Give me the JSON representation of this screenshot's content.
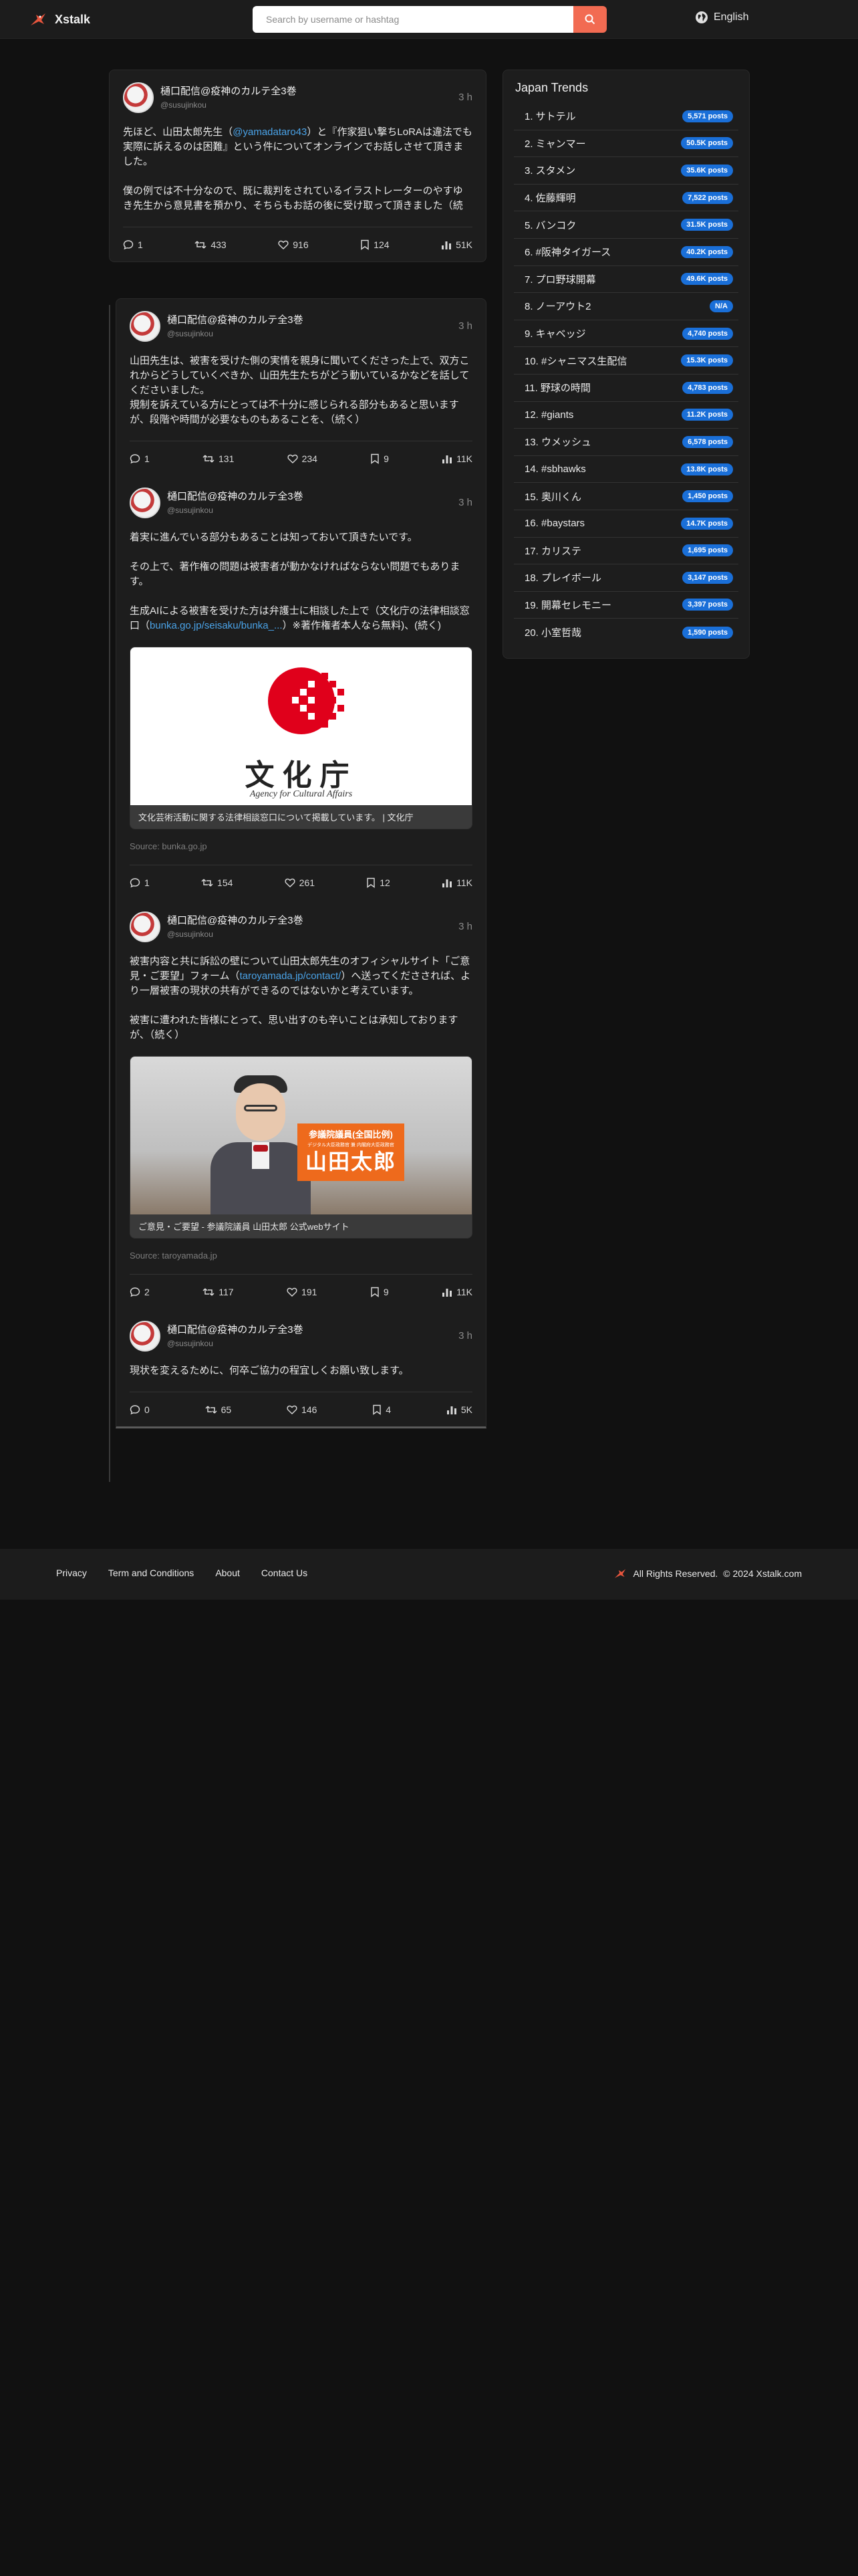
{
  "header": {
    "brand": "Xstalk",
    "search_placeholder": "Search by username or hashtag",
    "language": "English"
  },
  "main_post": {
    "display_name": "樋口配信@疫神のカルテ全3巻",
    "handle": "@susujinkou",
    "time": "3 h",
    "text_1a": "先ほど、山田太郎先生（",
    "text_1link": "@yamadataro43",
    "text_1b": "）と『作家狙い撃ちLoRAは違法でも実際に訴えるのは困難』という件についてオンラインでお話しさせて頂きました。",
    "text_2": "僕の例では不十分なので、既に裁判をされているイラストレーターのやすゆき先生から意見書を預かり、そちらもお話の後に受け取って頂きました（続",
    "replies": "1",
    "reposts": "433",
    "likes": "916",
    "bookmarks": "124",
    "views": "51K"
  },
  "thread": [
    {
      "display_name": "樋口配信@疫神のカルテ全3巻",
      "handle": "@susujinkou",
      "time": "3 h",
      "text_1": "山田先生は、被害を受けた側の実情を親身に聞いてくださった上で、双方これからどうしていくべきか、山田先生たちがどう動いているかなどを話してくださいました。",
      "text_2": "規制を訴えている方にとっては不十分に感じられる部分もあると思いますが、段階や時間が必要なものもあることを、（続く）",
      "replies": "1",
      "reposts": "131",
      "likes": "234",
      "bookmarks": "9",
      "views": "11K"
    },
    {
      "display_name": "樋口配信@疫神のカルテ全3巻",
      "handle": "@susujinkou",
      "time": "3 h",
      "text_1": "着実に進んでいる部分もあることは知っておいて頂きたいです。",
      "text_2": "その上で、著作権の問題は被害者が動かなければならない問題でもあります。",
      "text_3a": "生成AIによる被害を受けた方は弁護士に相談した上で（文化庁の法律相談窓口（",
      "text_3link": "bunka.go.jp/seisaku/bunka_...",
      "text_3b": "）※著作権者本人なら無料)、(続く)",
      "preview_caption": "文化芸術活動に関する法律相談窓口について掲載しています。 | 文化庁",
      "preview_logo_text": "文化庁",
      "preview_logo_en": "Agency for Cultural Affairs",
      "source": "Source: bunka.go.jp",
      "replies": "1",
      "reposts": "154",
      "likes": "261",
      "bookmarks": "12",
      "views": "11K"
    },
    {
      "display_name": "樋口配信@疫神のカルテ全3巻",
      "handle": "@susujinkou",
      "time": "3 h",
      "text_1a": "被害内容と共に訴訟の壁について山田太郎先生のオフィシャルサイト「ご意見・ご要望」フォーム（",
      "text_1link": "taroyamada.jp/contact/",
      "text_1b": "）へ送ってくださされば、より一層被害の現状の共有ができるのではないかと考えています。",
      "text_2": "被害に遭われた皆様にとって、思い出すのも辛いことは承知しておりますが、（続く）",
      "preview_caption": "ご意見・ご要望 - 参議院議員 山田太郎 公式webサイト",
      "preview_sign_top": "参議院議員(全国比例)",
      "preview_sign_sub": "デジタル大臣政務官 兼 内閣府大臣政務官",
      "preview_sign_name": "山田太郎",
      "source": "Source: taroyamada.jp",
      "replies": "2",
      "reposts": "117",
      "likes": "191",
      "bookmarks": "9",
      "views": "11K"
    },
    {
      "display_name": "樋口配信@疫神のカルテ全3巻",
      "handle": "@susujinkou",
      "time": "3 h",
      "text_1": "現状を変えるために、何卒ご協力の程宜しくお願い致します。",
      "replies": "0",
      "reposts": "65",
      "likes": "146",
      "bookmarks": "4",
      "views": "5K"
    }
  ],
  "trends": {
    "title": "Japan Trends",
    "items": [
      {
        "label": "1. サトテル",
        "count": "5,571 posts"
      },
      {
        "label": "2. ミャンマー",
        "count": "50.5K posts"
      },
      {
        "label": "3. スタメン",
        "count": "35.6K posts"
      },
      {
        "label": "4. 佐藤輝明",
        "count": "7,522 posts"
      },
      {
        "label": "5. バンコク",
        "count": "31.5K posts"
      },
      {
        "label": "6. #阪神タイガース",
        "count": "40.2K posts"
      },
      {
        "label": "7. プロ野球開幕",
        "count": "49.6K posts"
      },
      {
        "label": "8. ノーアウト2",
        "count": "N/A"
      },
      {
        "label": "9. キャベッジ",
        "count": "4,740 posts"
      },
      {
        "label": "10. #シャニマス生配信",
        "count": "15.3K posts"
      },
      {
        "label": "11. 野球の時間",
        "count": "4,783 posts"
      },
      {
        "label": "12. #giants",
        "count": "11.2K posts"
      },
      {
        "label": "13. ウメッシュ",
        "count": "6,578 posts"
      },
      {
        "label": "14. #sbhawks",
        "count": "13.8K posts"
      },
      {
        "label": "15. 奥川くん",
        "count": "1,450 posts"
      },
      {
        "label": "16. #baystars",
        "count": "14.7K posts"
      },
      {
        "label": "17. カリステ",
        "count": "1,695 posts"
      },
      {
        "label": "18. プレイボール",
        "count": "3,147 posts"
      },
      {
        "label": "19. 開幕セレモニー",
        "count": "3,397 posts"
      },
      {
        "label": "20. 小室哲哉",
        "count": "1,590 posts"
      }
    ]
  },
  "footer": {
    "privacy": "Privacy",
    "terms": "Term and Conditions",
    "about": "About",
    "contact": "Contact Us",
    "rights": "All Rights Reserved.",
    "copyright": "© 2024 Xstalk.com"
  },
  "colors": {
    "accent": "#f26b52",
    "link": "#4aa3e8",
    "badge": "#1a6fd8",
    "background": "#111111",
    "card": "#1d1d1d"
  }
}
